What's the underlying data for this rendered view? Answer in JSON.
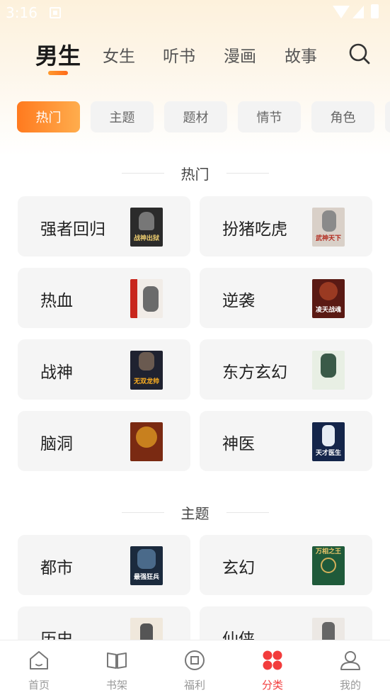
{
  "status_bar": {
    "time": "3:16"
  },
  "top_tabs": [
    {
      "label": "男生",
      "active": true
    },
    {
      "label": "女生",
      "active": false
    },
    {
      "label": "听书",
      "active": false
    },
    {
      "label": "漫画",
      "active": false
    },
    {
      "label": "故事",
      "active": false
    }
  ],
  "filter_chips": [
    {
      "label": "热门",
      "active": true
    },
    {
      "label": "主题",
      "active": false
    },
    {
      "label": "题材",
      "active": false
    },
    {
      "label": "情节",
      "active": false
    },
    {
      "label": "角色",
      "active": false
    }
  ],
  "sections": [
    {
      "title": "热门",
      "items": [
        {
          "label": "强者回归",
          "cover_text": "战神出狱",
          "cover_color": "#2b2b2b"
        },
        {
          "label": "扮猪吃虎",
          "cover_text": "武神天下",
          "cover_color": "#d9d0c8"
        },
        {
          "label": "热血",
          "cover_text": "",
          "cover_color": "#f1ece7"
        },
        {
          "label": "逆袭",
          "cover_text": "凌天战魂",
          "cover_color": "#5a1a14"
        },
        {
          "label": "战神",
          "cover_text": "无双龙帅",
          "cover_color": "#1f2230"
        },
        {
          "label": "东方玄幻",
          "cover_text": "",
          "cover_color": "#e8efe4"
        },
        {
          "label": "脑洞",
          "cover_text": "",
          "cover_color": "#7a2a12"
        },
        {
          "label": "神医",
          "cover_text": "天才医生",
          "cover_color": "#14254a"
        }
      ]
    },
    {
      "title": "主题",
      "items": [
        {
          "label": "都市",
          "cover_text": "最强狂兵",
          "cover_color": "#1b2a3d"
        },
        {
          "label": "玄幻",
          "cover_text": "万相之王",
          "cover_color": "#1f5a3a"
        },
        {
          "label": "历史",
          "cover_text": "",
          "cover_color": "#f0e8dc"
        },
        {
          "label": "仙侠",
          "cover_text": "",
          "cover_color": "#ece8e4"
        }
      ]
    }
  ],
  "bottom_nav": [
    {
      "label": "首页",
      "icon": "home-icon",
      "active": false
    },
    {
      "label": "书架",
      "icon": "bookshelf-icon",
      "active": false
    },
    {
      "label": "福利",
      "icon": "gift-icon",
      "active": false
    },
    {
      "label": "分类",
      "icon": "category-icon",
      "active": true
    },
    {
      "label": "我的",
      "icon": "profile-icon",
      "active": false
    }
  ],
  "colors": {
    "accent_orange": "#ff7a1f",
    "accent_red": "#f23c3c"
  }
}
